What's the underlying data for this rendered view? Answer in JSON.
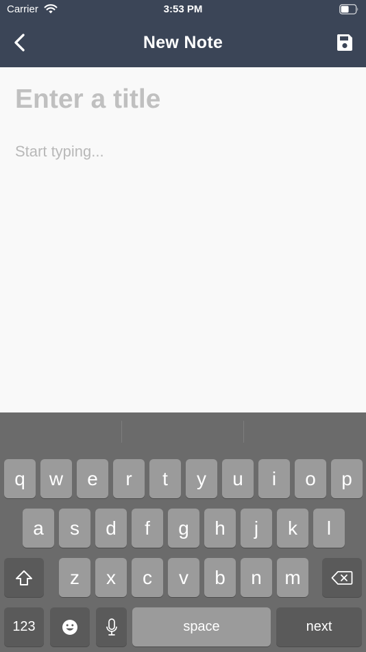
{
  "status_bar": {
    "carrier": "Carrier",
    "time": "3:53 PM",
    "wifi_icon": "wifi-icon",
    "battery_icon": "battery-icon"
  },
  "nav_bar": {
    "title": "New Note",
    "back_icon": "chevron-left-icon",
    "save_icon": "floppy-disk-icon",
    "background": "#3b4557"
  },
  "editor": {
    "title_placeholder": "Enter a title",
    "title_value": "",
    "body_placeholder": "Start typing...",
    "body_value": ""
  },
  "keyboard": {
    "row1": [
      "q",
      "w",
      "e",
      "r",
      "t",
      "y",
      "u",
      "i",
      "o",
      "p"
    ],
    "row2": [
      "a",
      "s",
      "d",
      "f",
      "g",
      "h",
      "j",
      "k",
      "l"
    ],
    "row3": [
      "z",
      "x",
      "c",
      "v",
      "b",
      "n",
      "m"
    ],
    "numbers_label": "123",
    "space_label": "space",
    "return_label": "next",
    "shift_icon": "shift-icon",
    "delete_icon": "backspace-icon",
    "emoji_icon": "emoji-icon",
    "mic_icon": "microphone-icon"
  }
}
